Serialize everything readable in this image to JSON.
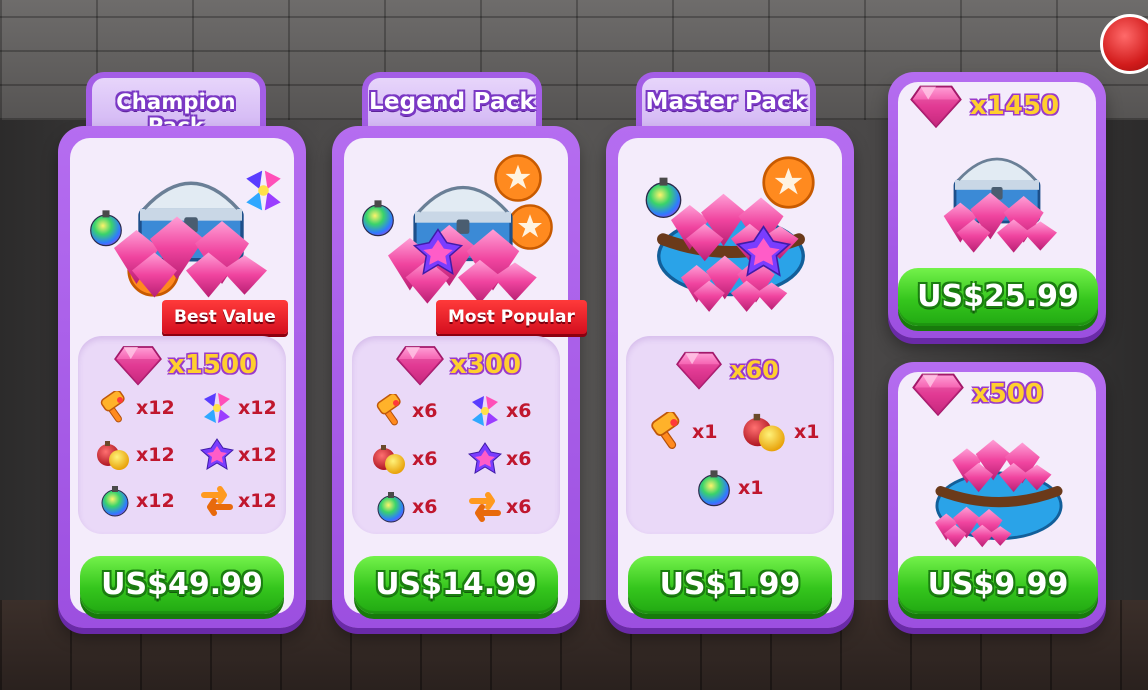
{
  "packs": [
    {
      "title": "Champion Pack",
      "badge": "Best Value",
      "gems": "x1500",
      "items": [
        {
          "icon": "hammer-icon",
          "qty": "x12"
        },
        {
          "icon": "rocket-icon",
          "qty": "x12"
        },
        {
          "icon": "bomb-icon",
          "qty": "x12"
        },
        {
          "icon": "firework-icon",
          "qty": "x12"
        },
        {
          "icon": "rainbow-ball-icon",
          "qty": "x12"
        },
        {
          "icon": "swap-icon",
          "qty": "x12"
        }
      ],
      "price": "US$49.99"
    },
    {
      "title": "Legend Pack",
      "badge": "Most Popular",
      "gems": "x300",
      "items": [
        {
          "icon": "hammer-icon",
          "qty": "x6"
        },
        {
          "icon": "rocket-icon",
          "qty": "x6"
        },
        {
          "icon": "bomb-icon",
          "qty": "x6"
        },
        {
          "icon": "firework-icon",
          "qty": "x6"
        },
        {
          "icon": "rainbow-ball-icon",
          "qty": "x6"
        },
        {
          "icon": "swap-icon",
          "qty": "x6"
        }
      ],
      "price": "US$14.99"
    },
    {
      "title": "Master Pack",
      "gems": "x60",
      "items": [
        {
          "icon": "hammer-icon",
          "qty": "x1"
        },
        {
          "icon": "bomb-icon",
          "qty": "x1"
        },
        {
          "icon": "rainbow-ball-icon",
          "qty": "x1"
        }
      ],
      "price": "US$1.99"
    }
  ],
  "gem_offers": [
    {
      "gems": "x1450",
      "price": "US$25.99"
    },
    {
      "gems": "x500",
      "price": "US$9.99"
    }
  ],
  "colors": {
    "card_purple": "#a45ee6",
    "price_green": "#35c61d",
    "gem_pink": "#e83a9c",
    "qty_yellow": "#ffcf2e",
    "ribbon_red": "#d40f1f"
  }
}
